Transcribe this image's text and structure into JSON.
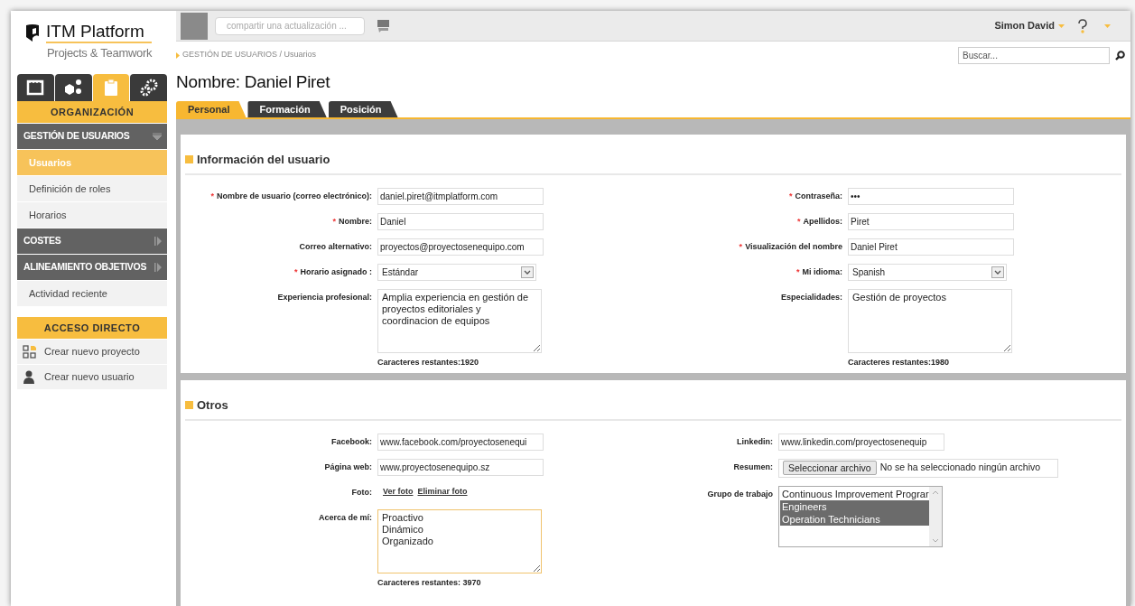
{
  "sidebar": {
    "logo": {
      "title": "ITM Platform",
      "subtitle": "Projects & Teamwork"
    },
    "module_tabs": [
      {
        "kind": "calendar",
        "selected": false
      },
      {
        "kind": "cubes",
        "selected": false
      },
      {
        "kind": "clipboard",
        "selected": true
      },
      {
        "kind": "gears",
        "selected": false
      }
    ],
    "module_title": "ORGANIZACIÓN",
    "menu": [
      {
        "label": "GESTIÓN DE USUARIOS",
        "kind": "section",
        "expanded": true
      },
      {
        "label": "Usuarios",
        "kind": "item",
        "selected": true
      },
      {
        "label": "Definición de roles",
        "kind": "item",
        "selected": false
      },
      {
        "label": "Horarios",
        "kind": "item",
        "selected": false
      },
      {
        "label": "COSTES",
        "kind": "section",
        "expanded": false
      },
      {
        "label": "ALINEAMIENTO OBJETIVOS",
        "kind": "section",
        "expanded": false
      },
      {
        "label": "Actividad reciente",
        "kind": "item",
        "selected": false
      }
    ],
    "shortcuts": {
      "title": "ACCESO DIRECTO",
      "items": [
        {
          "label": "Crear nuevo proyecto",
          "kind": "project"
        },
        {
          "label": "Crear nuevo usuario",
          "kind": "user"
        }
      ]
    }
  },
  "topbar": {
    "share_placeholder": "compartir una actualización ...",
    "user_name": "Simon David"
  },
  "breadcrumb": "GESTIÓN DE USUARIOS / Usuarios",
  "search": {
    "placeholder": "Buscar..."
  },
  "page_title": "Nombre: Daniel Piret",
  "tabs": [
    {
      "label": "Personal",
      "selected": true
    },
    {
      "label": "Formación",
      "selected": false
    },
    {
      "label": "Posición",
      "selected": false
    }
  ],
  "sections": [
    {
      "title": "Información del usuario",
      "left": [
        {
          "label": "Nombre de usuario (correo electrónico):",
          "required_mark": "*",
          "kind": "text",
          "value": "daniel.piret@itmplatform.com"
        },
        {
          "label": "Nombre:",
          "required_mark": "*",
          "kind": "text",
          "value": "Daniel"
        },
        {
          "label": "Correo alternativo:",
          "kind": "text",
          "value": "proyectos@proyectosenequipo.com"
        },
        {
          "label": "Horario asignado :",
          "required_mark": "*",
          "kind": "select",
          "value": "Estándar"
        },
        {
          "label": "Experiencia profesional:",
          "kind": "textarea",
          "value": "Amplia experiencia en gestión de proyectos editoriales y coordinacion de equipos",
          "counter": "Caracteres restantes:1920",
          "focused": false
        }
      ],
      "right": [
        {
          "label": "Contraseña:",
          "required_mark": "*",
          "kind": "text",
          "value": "•••"
        },
        {
          "label": "Apellidos:",
          "required_mark": "*",
          "kind": "text",
          "value": "Piret"
        },
        {
          "label": "Visualización del nombre",
          "required_mark": "*",
          "kind": "text",
          "value": "Daniel Piret"
        },
        {
          "label": "Mi idioma:",
          "required_mark": "*",
          "kind": "select",
          "value": "Spanish"
        },
        {
          "label": "Especialidades:",
          "kind": "textarea",
          "value": "Gestión de proyectos",
          "counter": "Caracteres restantes:1980",
          "focused": false
        }
      ]
    },
    {
      "title": "Otros",
      "left": [
        {
          "label": "Facebook:",
          "kind": "text",
          "value": "www.facebook.com/proyectosenequi"
        },
        {
          "label": "Página web:",
          "kind": "text",
          "value": "www.proyectosenequipo.sz"
        },
        {
          "label": "Foto:",
          "kind": "links",
          "links": [
            "Ver foto",
            "Eliminar foto"
          ]
        },
        {
          "label": "Acerca de mí:",
          "kind": "textarea",
          "value": "Proactivo\nDinámico\nOrganizado",
          "counter": "Caracteres restantes: 3970",
          "focused": true
        }
      ],
      "right": [
        {
          "label": "Linkedin:",
          "kind": "text",
          "value": "www.linkedin.com/proyectosenequip"
        },
        {
          "label": "Resumen:",
          "kind": "file",
          "button": "Seleccionar archivo",
          "value": "No se ha seleccionado ningún archivo"
        },
        {
          "label": "Grupo de trabajo",
          "kind": "listbox",
          "options": [
            {
              "label": "Continuous Improvement Prograr",
              "selected": false
            },
            {
              "label": "Engineers",
              "selected": true
            },
            {
              "label": "Operation Technicians",
              "selected": true
            }
          ]
        }
      ]
    }
  ]
}
